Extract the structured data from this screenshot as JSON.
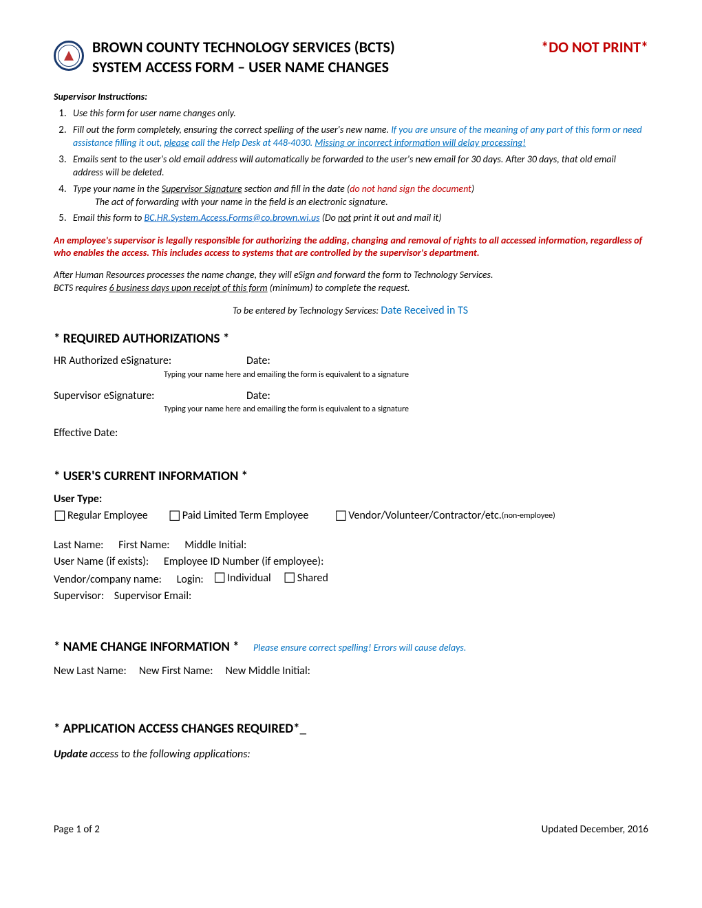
{
  "header": {
    "title1": "BROWN COUNTY TECHNOLOGY SERVICES (BCTS)",
    "do_not_print": "*DO NOT PRINT*",
    "title2": "SYSTEM ACCESS FORM – USER NAME CHANGES"
  },
  "instructions": {
    "heading": "Supervisor Instructions:",
    "item1": "Use this form for user name changes only.",
    "item2a": "Fill out the form completely, ensuring the correct spelling of the user's new name.  ",
    "item2b": "If you are unsure of the meaning of any part of this form or need assistance filling it out, ",
    "item2c": "please",
    "item2d": " call the Help Desk at 448-4030. ",
    "item2e": "Missing or incorrect information will delay processing!",
    "item3": "Emails sent to the user's old email address will automatically be forwarded to the user's new email for 30 days.  After 30 days, that old email address will be deleted.",
    "item4a": "Type your name in the ",
    "item4b": "Supervisor Signature",
    "item4c": " section and fill in the date (",
    "item4d": "do not hand sign the document",
    "item4e": ")",
    "item4f": "The act of forwarding with your name in the field is an electronic signature.",
    "item5a": "Email this form to ",
    "item5b": "BC.HR.System.Access.Forms@co.brown.wi.us",
    "item5c": "   (Do ",
    "item5d": "not",
    "item5e": " print it out and mail it)"
  },
  "legal": "An employee's supervisor is legally responsible for authorizing the adding, changing and removal of rights to all accessed information, regardless of who enables the access.  This includes access to systems that are controlled by the supervisor's department.",
  "after_hr1": "After Human Resources processes the name change, they will eSign and forward the form to Technology Services.",
  "after_hr2a": "BCTS requires ",
  "after_hr2b": "6 business days upon receipt of this form",
  "after_hr2c": " (minimum) to complete the request.",
  "ts": {
    "label": "To be entered by Technology Services: ",
    "value": "Date Received in TS"
  },
  "auth": {
    "heading": "* REQUIRED AUTHORIZATIONS *",
    "hr_label": "HR Authorized eSignature:",
    "date_label": "Date:",
    "note": "Typing your name here and emailing the form is equivalent to a signature",
    "sup_label": "Supervisor eSignature:",
    "eff_label": "Effective Date:"
  },
  "user_info": {
    "heading": "* USER'S CURRENT INFORMATION *",
    "user_type_label": "User Type:",
    "opt_regular": "Regular Employee",
    "opt_paid": "Paid Limited Term Employee",
    "opt_vendor": "Vendor/Volunteer/Contractor/etc. ",
    "opt_vendor_note": "(non-employee)",
    "last_name": "Last Name:",
    "first_name": "First Name:",
    "middle_initial": "Middle Initial:",
    "user_name": "User Name (if exists):",
    "emp_id": "Employee ID Number (if employee):",
    "vendor_company": "Vendor/company name:",
    "login_label": "Login:",
    "login_individual": "Individual",
    "login_shared": "Shared",
    "supervisor": "Supervisor:",
    "supervisor_email": "Supervisor Email:"
  },
  "name_change": {
    "heading": "* NAME CHANGE INFORMATION *",
    "note": "Please ensure correct spelling!  Errors will cause delays.",
    "new_last": "New Last Name:",
    "new_first": "New First Name:",
    "new_mi": "New Middle Initial:"
  },
  "app_access": {
    "heading": "* APPLICATION ACCESS CHANGES REQUIRED*",
    "update_word": "Update",
    "update_rest": " access to the following applications:"
  },
  "footer": {
    "page": "Page 1 of 2",
    "updated": "Updated December, 2016"
  }
}
